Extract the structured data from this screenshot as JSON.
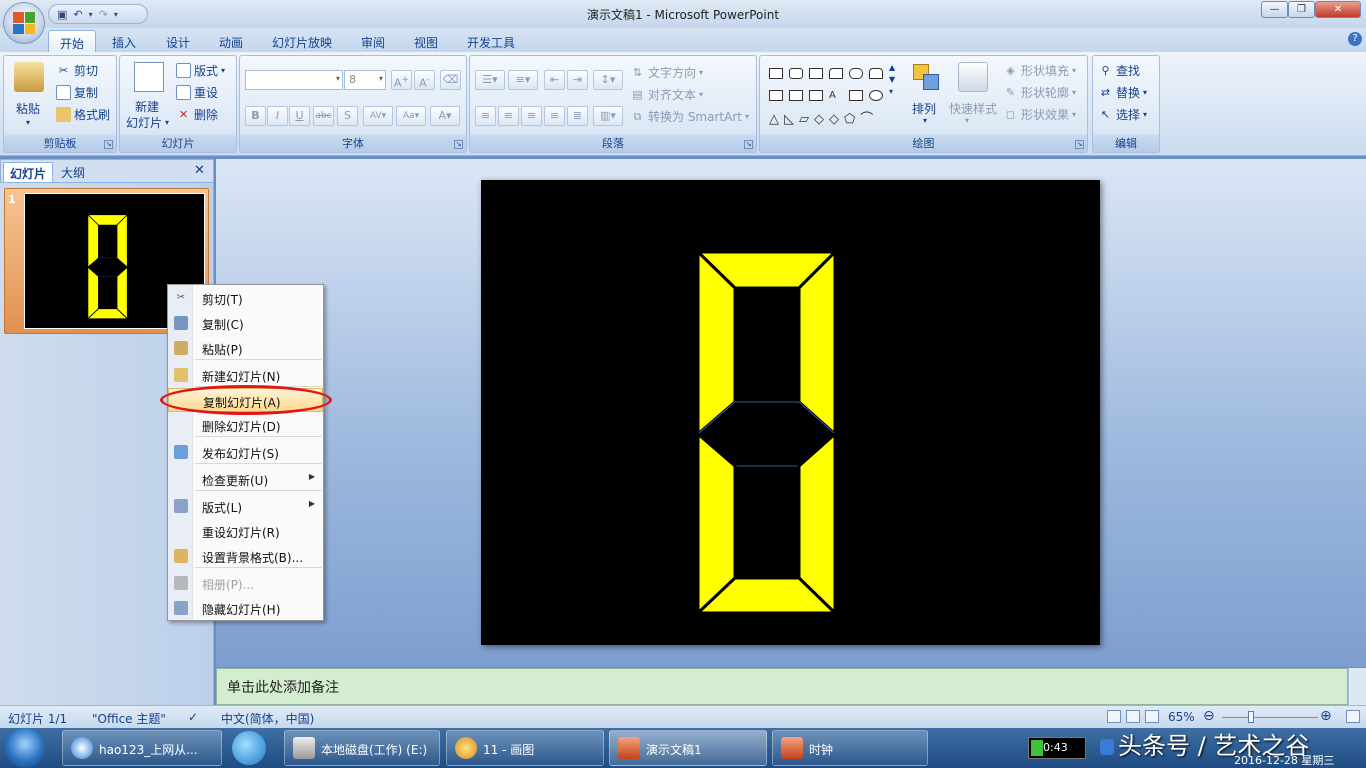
{
  "window": {
    "title": "演示文稿1 - Microsoft PowerPoint",
    "min": "—",
    "max": "❐",
    "close": "✕"
  },
  "ribbon_tabs": [
    "开始",
    "插入",
    "设计",
    "动画",
    "幻灯片放映",
    "审阅",
    "视图",
    "开发工具"
  ],
  "groups": {
    "clipboard": {
      "label": "剪贴板",
      "paste": "粘贴",
      "cut": "剪切",
      "copy": "复制",
      "format_painter": "格式刷"
    },
    "slides": {
      "label": "幻灯片",
      "new_slide_1": "新建",
      "new_slide_2": "幻灯片",
      "layout": "版式",
      "reset": "重设",
      "delete": "删除"
    },
    "font": {
      "label": "字体",
      "font_name": "",
      "font_size": "8"
    },
    "paragraph": {
      "label": "段落",
      "text_direction": "文字方向",
      "align_text": "对齐文本",
      "smartart": "转换为 SmartArt"
    },
    "drawing": {
      "label": "绘图",
      "arrange": "排列",
      "quick_styles": "快速样式",
      "shape_fill": "形状填充",
      "shape_outline": "形状轮廓",
      "shape_effects": "形状效果"
    },
    "editing": {
      "label": "编辑",
      "find": "查找",
      "replace": "替换",
      "select": "选择"
    }
  },
  "panel_tabs": [
    "幻灯片",
    "大纲"
  ],
  "thumbnail_number": "1",
  "context_menu": [
    {
      "label": "剪切(T)",
      "icon": "scissors-icon",
      "disabled": false,
      "submenu": false
    },
    {
      "label": "复制(C)",
      "icon": "copy-icon",
      "disabled": false,
      "submenu": false
    },
    {
      "label": "粘贴(P)",
      "icon": "paste-icon",
      "disabled": false,
      "submenu": false
    },
    {
      "label": "新建幻灯片(N)",
      "icon": "new-slide-icon",
      "disabled": false,
      "submenu": false
    },
    {
      "label": "复制幻灯片(A)",
      "icon": "",
      "disabled": false,
      "submenu": false
    },
    {
      "label": "删除幻灯片(D)",
      "icon": "",
      "disabled": false,
      "submenu": false
    },
    {
      "label": "发布幻灯片(S)",
      "icon": "publish-icon",
      "disabled": false,
      "submenu": false
    },
    {
      "label": "检查更新(U)",
      "icon": "",
      "disabled": false,
      "submenu": true
    },
    {
      "label": "版式(L)",
      "icon": "layout-icon",
      "disabled": false,
      "submenu": true
    },
    {
      "label": "重设幻灯片(R)",
      "icon": "",
      "disabled": false,
      "submenu": false
    },
    {
      "label": "设置背景格式(B)...",
      "icon": "background-icon",
      "disabled": false,
      "submenu": false
    },
    {
      "label": "相册(P)...",
      "icon": "album-icon",
      "disabled": true,
      "submenu": false
    },
    {
      "label": "隐藏幻灯片(H)",
      "icon": "hide-slide-icon",
      "disabled": false,
      "submenu": false
    }
  ],
  "notes_placeholder": "单击此处添加备注",
  "status": {
    "slide_count": "幻灯片 1/1",
    "theme": "\"Office 主题\"",
    "language": "中文(简体，中国)",
    "zoom": "65%",
    "zoom_percent": 65
  },
  "taskbar": {
    "items": [
      "hao123_上网从...",
      "本地磁盘(工作) (E:)",
      "11 - 画图",
      "演示文稿1",
      "时钟"
    ],
    "battery": "0:43",
    "datetime": "2016-12-28 星期三"
  },
  "watermark": "头条号 / 艺术之谷",
  "colors": {
    "segment": "#ffff00",
    "slide_bg": "#000000",
    "highlight_ring": "#e0161b",
    "notes_bg": "#d4ecd0"
  }
}
